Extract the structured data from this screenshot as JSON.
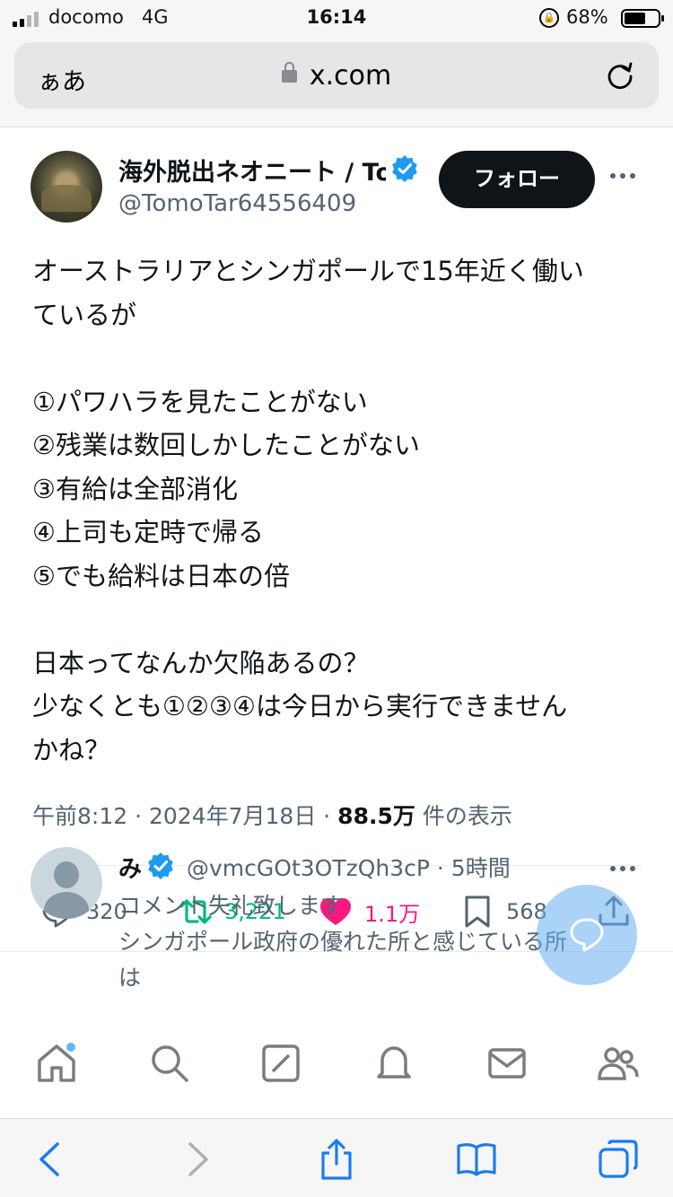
{
  "status_bar": {
    "carrier": "docomo",
    "network": "4G",
    "time": "16:14",
    "battery": "68%",
    "battery_level": 0.68
  },
  "browser": {
    "text_size_button": "ぁあ",
    "url": "x.com"
  },
  "tweet": {
    "author_name": "海外脱出ネオニート / Tomo",
    "author_handle": "@TomoTar64556409",
    "follow_label": "フォロー",
    "lines": [
      "オーストラリアとシンガポールで15年近く働い",
      "ているが",
      "",
      "①パワハラを見たことがない",
      "②残業は数回しかしたことがない",
      "③有給は全部消化",
      "④上司も定時で帰る",
      "⑤でも給料は日本の倍",
      "",
      "日本ってなんか欠陥あるの？",
      "少なくとも①②③④は今日から実行できません",
      "かね？"
    ],
    "time": "午前8:12",
    "date": "2024年7月18日",
    "views": "88.5万",
    "views_label": "件の表示",
    "replies": "320",
    "retweets": "3,221",
    "likes": "1.1万",
    "bookmarks": "568"
  },
  "reply": {
    "name": "み",
    "handle_time": "@vmcGOt3OTzQh3cP · 5時間",
    "lines": [
      "コメント失礼致します",
      "シンガポール政府の優れた所と感じている所",
      "は"
    ]
  },
  "colors": {
    "accent": "#1d9bf0",
    "retweet": "#00ba7c",
    "like": "#f91880",
    "text": "#0f1419",
    "secondary": "#536471"
  }
}
